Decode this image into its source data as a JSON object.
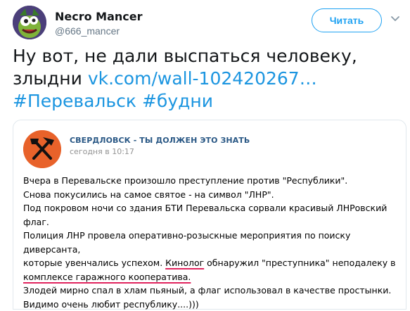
{
  "author": {
    "name": "Necro Mancer",
    "handle": "@666_mancer"
  },
  "actions": {
    "follow_label": "Читать"
  },
  "tweet": {
    "line1": "Ну вот, не дали выспаться человеку,",
    "line2_text": "злыдни ",
    "link": "vk.com/wall-102420267…",
    "hashtag1": "#Перевальск",
    "hashtag2": "#будни"
  },
  "card": {
    "title": "СВЕРДЛОВСК - ТЫ ДОЛЖЕН ЭТО ЗНАТЬ",
    "time": "сегодня в 10:17",
    "p1": "Вчера в Перевальске произошло преступление против \"Республики\".",
    "p2": "Снова покусились на самое святое - на символ \"ЛНР\".",
    "p3": "Под покровом ночи со здания БТИ Перевальска сорвали красивый ЛНРовский флаг.",
    "p4a": "Полиция ЛНР провела оперативно-розыскные мероприятия по поиску диверсанта,",
    "p4b_before": "которые увенчались успехом. ",
    "p4b_underlined": "Кинолог",
    "p4b_after": " обнаружил \"преступника\" неподалеку в",
    "p4c": "комплексе гаражного кооператива.",
    "p5": "Злодей мирно спал в хлам пьяный, а флаг использовал в качестве простынки.",
    "p6": "Видимо очень любит республику....)))"
  },
  "colors": {
    "link": "#1b95e0",
    "accent": "#1da1f2",
    "card_title": "#2a5885",
    "underline": "#e0245e"
  }
}
